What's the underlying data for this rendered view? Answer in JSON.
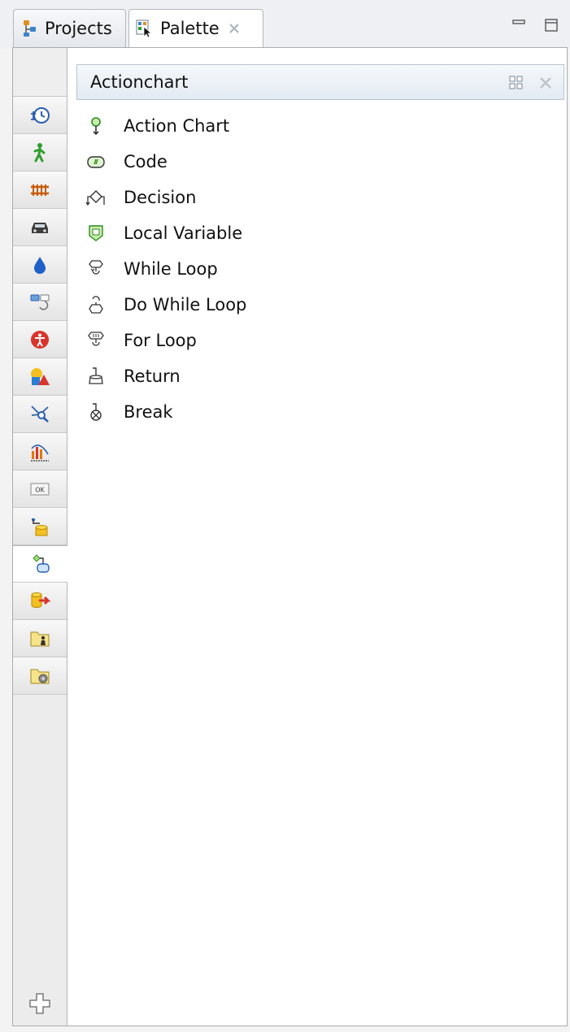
{
  "tabs": [
    {
      "label": "Projects",
      "icon": "projects-icon"
    },
    {
      "label": "Palette",
      "icon": "palette-icon"
    }
  ],
  "drawer": {
    "title": "Actionchart",
    "items": [
      {
        "label": "Action Chart",
        "icon": "action-chart-icon"
      },
      {
        "label": "Code",
        "icon": "code-icon"
      },
      {
        "label": "Decision",
        "icon": "decision-icon"
      },
      {
        "label": "Local Variable",
        "icon": "local-variable-icon"
      },
      {
        "label": "While Loop",
        "icon": "while-loop-icon"
      },
      {
        "label": "Do While Loop",
        "icon": "do-while-loop-icon"
      },
      {
        "label": "For Loop",
        "icon": "for-loop-icon"
      },
      {
        "label": "Return",
        "icon": "return-icon"
      },
      {
        "label": "Break",
        "icon": "break-icon"
      }
    ]
  },
  "palette_categories": [
    "clock-icon",
    "pedestrian-icon",
    "rail-icon",
    "car-icon",
    "drop-icon",
    "process-icon",
    "accessibility-icon",
    "shapes-icon",
    "network-icon",
    "chart-icon",
    "ok-button-icon",
    "connector-icon",
    "actionchart-icon",
    "database-icon",
    "folder-person-icon",
    "folder-gear-icon"
  ],
  "active_category": "actionchart-icon",
  "colors": {
    "header_bg": "#e3eaf2",
    "accent_green": "#2e9e2e",
    "accent_orange": "#e07800",
    "accent_blue": "#1e5fc8"
  }
}
